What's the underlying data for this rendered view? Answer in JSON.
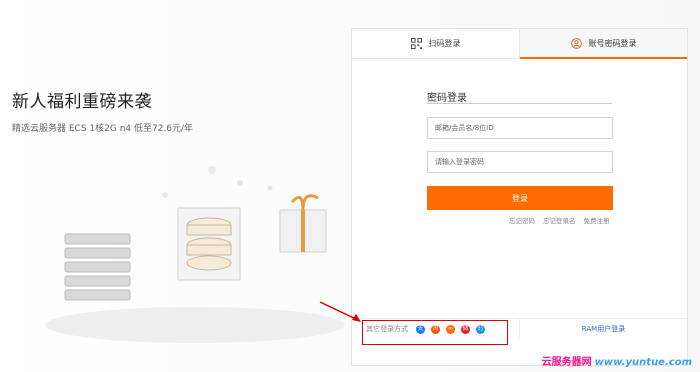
{
  "hero": {
    "title": "新人福利重磅来袭",
    "subtitle": "精选云服务器 ECS 1核2G n4 低至72.6元/年"
  },
  "login": {
    "tabs": [
      {
        "label": "扫码登录",
        "icon": "qr-code-icon"
      },
      {
        "label": "账号密码登录",
        "icon": "user-icon"
      }
    ],
    "form_title": "密码登录",
    "username_placeholder": "邮箱/会员名/8位ID",
    "password_placeholder": "请输入登录密码",
    "submit_label": "登录",
    "links": [
      "忘记密码",
      "忘记登录名",
      "免费注册"
    ],
    "other_methods_label": "其它登录方式",
    "social_icons": [
      "alipay-icon",
      "taobao-icon",
      "alibaba-icon",
      "weibo-icon",
      "dingtalk-icon"
    ],
    "ram_label": "RAM用户登录"
  },
  "colors": {
    "accent": "#ff6a00",
    "link": "#2b68c9",
    "annotation": "#dd0000"
  },
  "watermark": {
    "site": "云服务器网",
    "url": "www.yuntue.com"
  }
}
